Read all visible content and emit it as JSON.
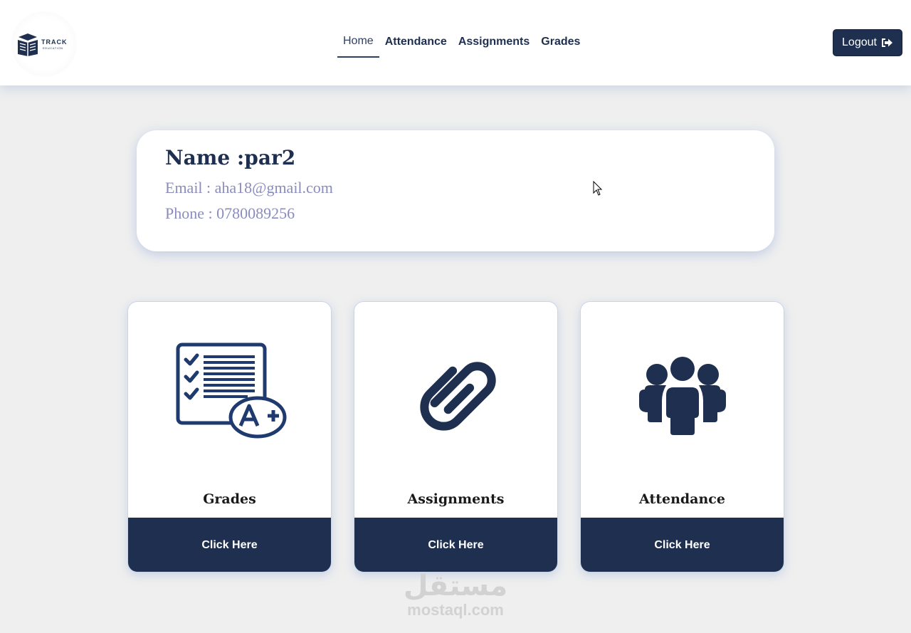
{
  "header": {
    "logo_text": "TRACK",
    "logo_subtext": "EDUCATION",
    "nav": [
      {
        "label": "Home",
        "active": true
      },
      {
        "label": "Attendance",
        "active": false
      },
      {
        "label": "Assignments",
        "active": false
      },
      {
        "label": "Grades",
        "active": false
      }
    ],
    "logout_label": "Logout",
    "logout_icon": "sign-out-icon"
  },
  "profile": {
    "name": "Name :par2",
    "email": "Email : aha18@gmail.com",
    "phone": "Phone : 0780089256"
  },
  "cards": [
    {
      "title": "Grades",
      "button": "Click Here",
      "icon": "grades-checklist-icon"
    },
    {
      "title": "Assignments",
      "button": "Click Here",
      "icon": "paperclip-icon"
    },
    {
      "title": "Attendance",
      "button": "Click Here",
      "icon": "group-icon"
    }
  ],
  "watermark": {
    "arabic": "مستقل",
    "latin": "mostaql.com"
  },
  "colors": {
    "primary": "#1e2f4f",
    "muted_text": "#8a8cbf",
    "background": "#efefef",
    "card_bg": "#ffffff"
  }
}
